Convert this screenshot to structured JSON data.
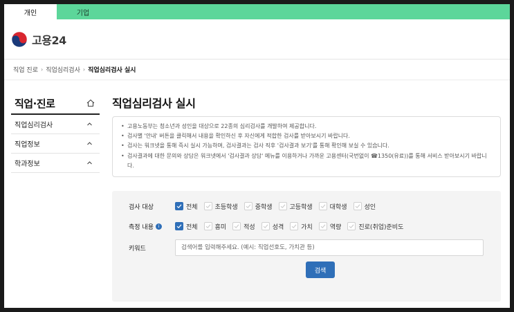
{
  "top_tabs": [
    {
      "label": "개인",
      "active": true
    },
    {
      "label": "기업",
      "active": false
    }
  ],
  "header": {
    "logo_text": "고용24"
  },
  "breadcrumb": {
    "items": [
      "직업 진로",
      "직업심리검사"
    ],
    "current": "직업심리검사 실시",
    "separator": "›"
  },
  "sidebar": {
    "title": "직업·진로",
    "items": [
      {
        "label": "직업심리검사"
      },
      {
        "label": "직업정보"
      },
      {
        "label": "학과정보"
      }
    ]
  },
  "main": {
    "title": "직업심리검사 실시",
    "notices": [
      "고용노동부는 청소년과 성인을 대상으로 22종의 심리검사를 개발하여 제공합니다.",
      "검사별 '안내' 버튼을 클릭해서 내용을 확인하신 후 자신에게 적합한 검사를 받아보시기 바랍니다.",
      "검사는 워크넷을 통해 즉시 실시 가능하며, 검사결과는 검사 직후 '검사결과 보기'를 통해 확인해 보실 수 있습니다.",
      "검사결과에 대한 문의와 상담은 워크넷에서 '검사결과 상담' 메뉴를 이용하거나 가까운 고용센터(국번없이 ☎1350(유료))를 통해 서비스 받아보시기 바랍니다."
    ]
  },
  "search": {
    "target_label": "검사 대상",
    "target_options": [
      {
        "label": "전체",
        "checked": true
      },
      {
        "label": "초등학생",
        "checked": false
      },
      {
        "label": "중학생",
        "checked": false
      },
      {
        "label": "고등학생",
        "checked": false
      },
      {
        "label": "대학생",
        "checked": false
      },
      {
        "label": "성인",
        "checked": false
      }
    ],
    "measure_label": "측정 내용",
    "measure_info_icon": "i",
    "measure_options": [
      {
        "label": "전체",
        "checked": true
      },
      {
        "label": "흥미",
        "checked": false
      },
      {
        "label": "적성",
        "checked": false
      },
      {
        "label": "성격",
        "checked": false
      },
      {
        "label": "가치",
        "checked": false
      },
      {
        "label": "역량",
        "checked": false
      },
      {
        "label": "진로(취업)준비도",
        "checked": false
      }
    ],
    "keyword_label": "키워드",
    "keyword_placeholder": "검색어를 입력해주세요. (예시: 직업선호도, 가치관 등)",
    "keyword_value": "",
    "button_label": "검색"
  },
  "colors": {
    "top_bar": "#5cd69a",
    "accent": "#2f6fb8"
  }
}
